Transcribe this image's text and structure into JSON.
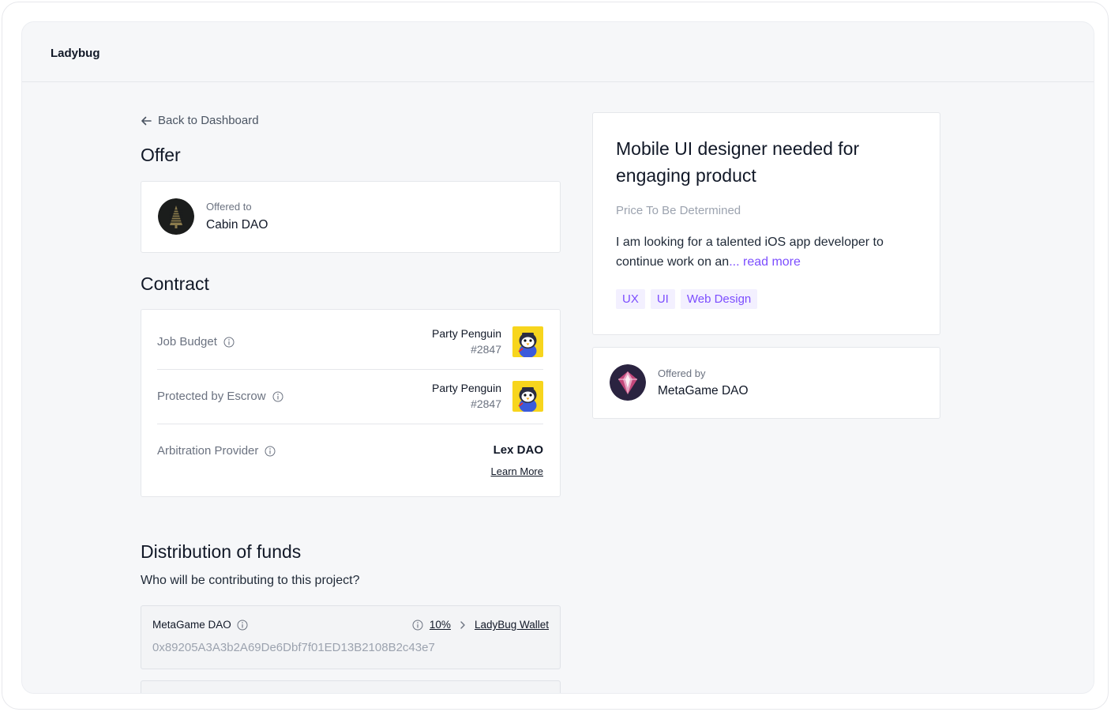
{
  "app": {
    "brand": "Ladybug"
  },
  "nav": {
    "back_label": "Back to Dashboard"
  },
  "offer": {
    "heading": "Offer",
    "offered_to_label": "Offered to",
    "offered_to_name": "Cabin DAO"
  },
  "contract": {
    "heading": "Contract",
    "rows": [
      {
        "label": "Job Budget",
        "nft_name": "Party Penguin",
        "nft_id": "#2847"
      },
      {
        "label": "Protected by Escrow",
        "nft_name": "Party Penguin",
        "nft_id": "#2847"
      },
      {
        "label": "Arbitration Provider",
        "provider": "Lex DAO",
        "link": "Learn More"
      }
    ]
  },
  "distribution": {
    "heading": "Distribution of funds",
    "question": "Who will be contributing to this project?",
    "funds": [
      {
        "name": "MetaGame DAO",
        "percent": "10%",
        "wallet": "LadyBug Wallet",
        "address": "0x89205A3A3b2A69De6Dbf7f01ED13B2108B2c43e7"
      }
    ]
  },
  "job": {
    "title": "Mobile UI designer needed for engaging product",
    "price": "Price To Be Determined",
    "description": "I am looking for a talented iOS app developer to continue work on an",
    "read_more": "... read more",
    "tags": [
      "UX",
      "UI",
      "Web Design"
    ]
  },
  "offered_by": {
    "label": "Offered by",
    "name": "MetaGame DAO"
  },
  "colors": {
    "accent": "#7c4dff",
    "tag_bg": "#f3f0ff",
    "page_bg": "#f6f7f9",
    "penguin_bg": "#f7d51d"
  }
}
